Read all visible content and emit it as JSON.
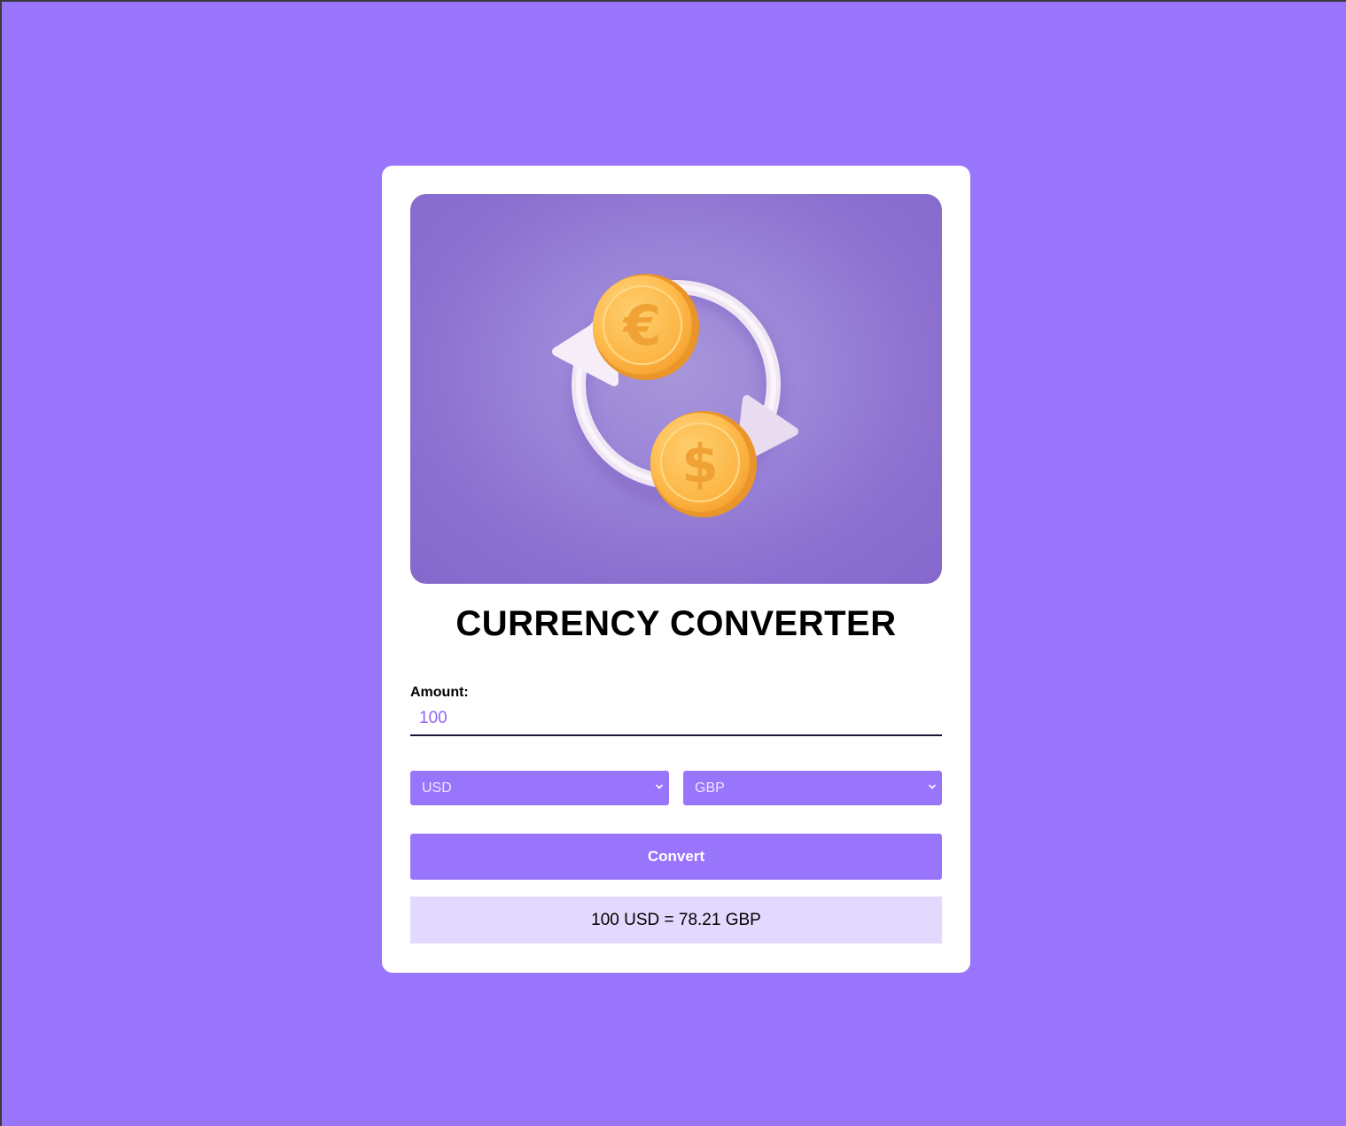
{
  "header": {
    "title": "CURRENCY CONVERTER"
  },
  "hero": {
    "icon": "currency-exchange-illustration",
    "coin_top_symbol": "€",
    "coin_bottom_symbol": "$"
  },
  "form": {
    "amount_label": "Amount:",
    "amount_value": "100",
    "from_currency": "USD",
    "to_currency": "GBP",
    "convert_label": "Convert"
  },
  "result": {
    "text": "100 USD = 78.21 GBP"
  },
  "colors": {
    "background": "#9975fc",
    "card": "#ffffff",
    "accent": "#9975fc",
    "result_bg": "#e3d9fe",
    "amount_text": "#8e66f5"
  }
}
